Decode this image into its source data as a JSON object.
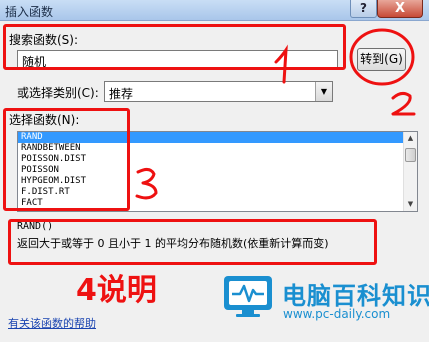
{
  "window": {
    "title": "插入函数",
    "help_button": "?",
    "close_button": "X"
  },
  "search": {
    "label": "搜索函数(S):",
    "value": "随机",
    "goto_button": "转到(G)"
  },
  "category": {
    "label": "或选择类别(C):",
    "selected": "推荐"
  },
  "function_list": {
    "label": "选择函数(N):",
    "items": [
      "RAND",
      "RANDBETWEEN",
      "POISSON.DIST",
      "POISSON",
      "HYPGEOM.DIST",
      "F.DIST.RT",
      "FACT"
    ],
    "selected_index": 0
  },
  "details": {
    "syntax": "RAND()",
    "description": "返回大于或等于 0 且小于 1 的平均分布随机数(依重新计算而变)"
  },
  "help_link": "有关该函数的帮助",
  "watermark": {
    "name": "电脑百科知识",
    "url": "www.pc-daily.com"
  },
  "annotations": {
    "mark_1": "1",
    "mark_2": "2",
    "mark_3": "3",
    "mark_4": "4说明",
    "color": "#ee1111"
  },
  "colors": {
    "selection": "#3399ff",
    "brand": "#1a8fd0",
    "link": "#1a44b0"
  }
}
